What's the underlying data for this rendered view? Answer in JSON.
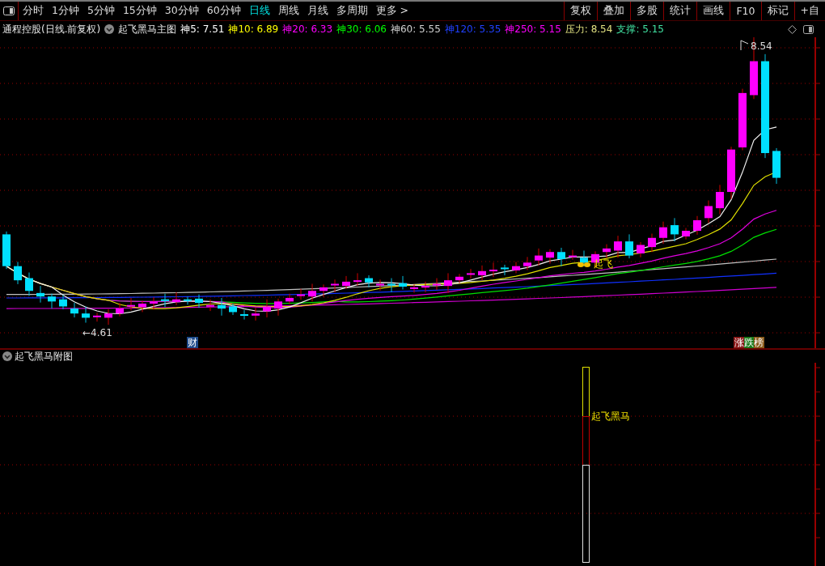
{
  "toolbar": {
    "periods": [
      {
        "label": "分时",
        "selected": false
      },
      {
        "label": "1分钟",
        "selected": false
      },
      {
        "label": "5分钟",
        "selected": false
      },
      {
        "label": "15分钟",
        "selected": false
      },
      {
        "label": "30分钟",
        "selected": false
      },
      {
        "label": "60分钟",
        "selected": false
      },
      {
        "label": "日线",
        "selected": true
      },
      {
        "label": "周线",
        "selected": false
      },
      {
        "label": "月线",
        "selected": false
      },
      {
        "label": "多周期",
        "selected": false
      },
      {
        "label": "更多 >",
        "selected": false
      }
    ],
    "actions": [
      "复权",
      "叠加",
      "多股",
      "统计",
      "画线",
      "F10",
      "标记",
      "+自"
    ]
  },
  "info_bar": {
    "stock": "通程控股(日线.前复权)",
    "indicator": "起飞黑马主图",
    "values": [
      {
        "text": "神5: 7.51",
        "color": "#ffffff"
      },
      {
        "text": "神10: 6.89",
        "color": "#ffff00"
      },
      {
        "text": "神20: 6.33",
        "color": "#ff00ff"
      },
      {
        "text": "神30: 6.06",
        "color": "#00ff00"
      },
      {
        "text": "神60: 5.55",
        "color": "#d0d0d0"
      },
      {
        "text": "神120: 5.35",
        "color": "#2040ff"
      },
      {
        "text": "神250: 5.15",
        "color": "#ff00ff"
      },
      {
        "text": "压力: 8.54",
        "color": "#e0e080"
      },
      {
        "text": "支撑: 5.15",
        "color": "#40e0a0"
      }
    ]
  },
  "main_chart": {
    "high_label": "8.54",
    "low_label": "←4.61",
    "signal_label": "起飞",
    "badges": [
      {
        "text": "财",
        "kind": "finance"
      },
      {
        "text": "涨跌榜",
        "kind": "ranking"
      }
    ]
  },
  "sub_chart": {
    "title": "起飞黑马附图",
    "signal_label": "起飞黑马"
  }
}
